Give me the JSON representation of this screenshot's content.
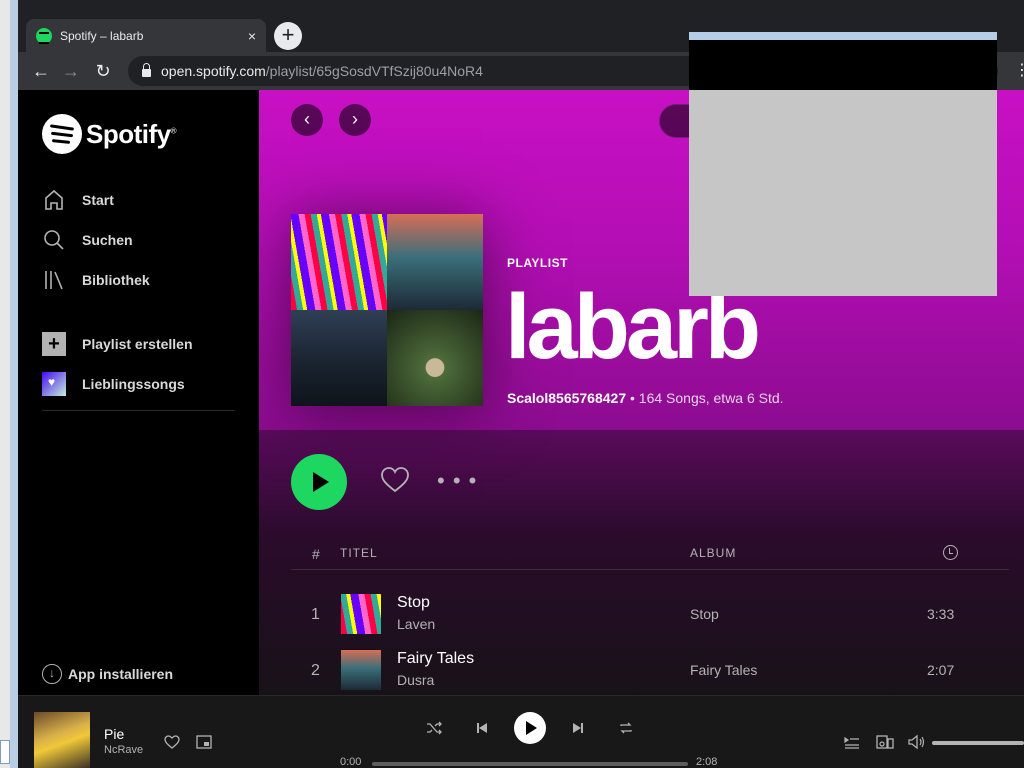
{
  "browser": {
    "tab_title": "Spotify – labarb",
    "tab_close": "×",
    "new_tab": "+",
    "url_host": "open.spotify.com",
    "url_path": "/playlist/65gSosdVTfSzij80u4NoR4",
    "back": "←",
    "forward": "→",
    "reload": "↻",
    "menu": "⋮"
  },
  "sidebar": {
    "brand": "Spotify",
    "items": [
      {
        "label": "Start",
        "icon": "home-icon"
      },
      {
        "label": "Suchen",
        "icon": "search-icon"
      },
      {
        "label": "Bibliothek",
        "icon": "library-icon"
      }
    ],
    "create_playlist": "Playlist erstellen",
    "liked_songs": "Lieblingssongs",
    "install_app": "App installieren"
  },
  "playlist": {
    "type": "PLAYLIST",
    "title": "labarb",
    "owner": "Scalol8565768427",
    "meta": " • 164 Songs, etwa 6 Std."
  },
  "table": {
    "headers": {
      "num": "#",
      "title": "TITEL",
      "album": "ALBUM"
    },
    "rows": [
      {
        "num": "1",
        "title": "Stop",
        "artist": "Laven",
        "album": "Stop",
        "duration": "3:33"
      },
      {
        "num": "2",
        "title": "Fairy Tales",
        "artist": "Dusra",
        "album": "Fairy Tales",
        "duration": "2:07"
      }
    ]
  },
  "player": {
    "track": "Pie",
    "artist": "NcRave",
    "elapsed": "0:00",
    "total": "2:08"
  },
  "colors": {
    "accent": "#1ed760",
    "hero": "#c810c4"
  }
}
